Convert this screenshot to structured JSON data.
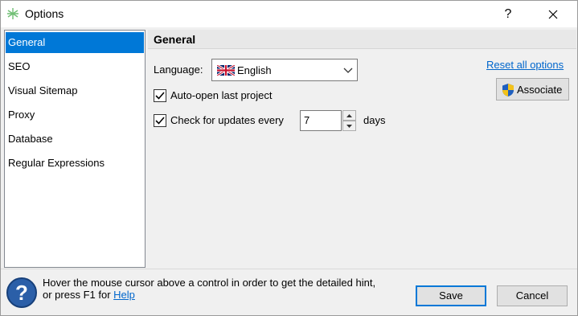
{
  "window": {
    "title": "Options",
    "help_glyph": "?",
    "close_glyph": "✕"
  },
  "sidebar": {
    "items": [
      {
        "label": "General",
        "selected": true
      },
      {
        "label": "SEO",
        "selected": false
      },
      {
        "label": "Visual Sitemap",
        "selected": false
      },
      {
        "label": "Proxy",
        "selected": false
      },
      {
        "label": "Database",
        "selected": false
      },
      {
        "label": "Regular Expressions",
        "selected": false
      }
    ]
  },
  "panel": {
    "title": "General",
    "language_label": "Language:",
    "language_value": "English",
    "language_icon": "uk-flag-icon",
    "auto_open_label": "Auto-open last project",
    "auto_open_checked": true,
    "check_updates_label": "Check for updates every",
    "check_updates_checked": true,
    "update_days_value": "7",
    "days_label": "days",
    "reset_link": "Reset all options",
    "associate_label": "Associate",
    "associate_icon": "shield-icon"
  },
  "footer": {
    "hint_line1": "Hover the mouse cursor above a control in order to get the detailed hint,",
    "hint_line2_prefix": "or press F1 for ",
    "help_link": "Help",
    "save_label": "Save",
    "cancel_label": "Cancel"
  },
  "colors": {
    "selection": "#0078d7",
    "link": "#0066cc",
    "window_bg": "#f0f0f0"
  }
}
